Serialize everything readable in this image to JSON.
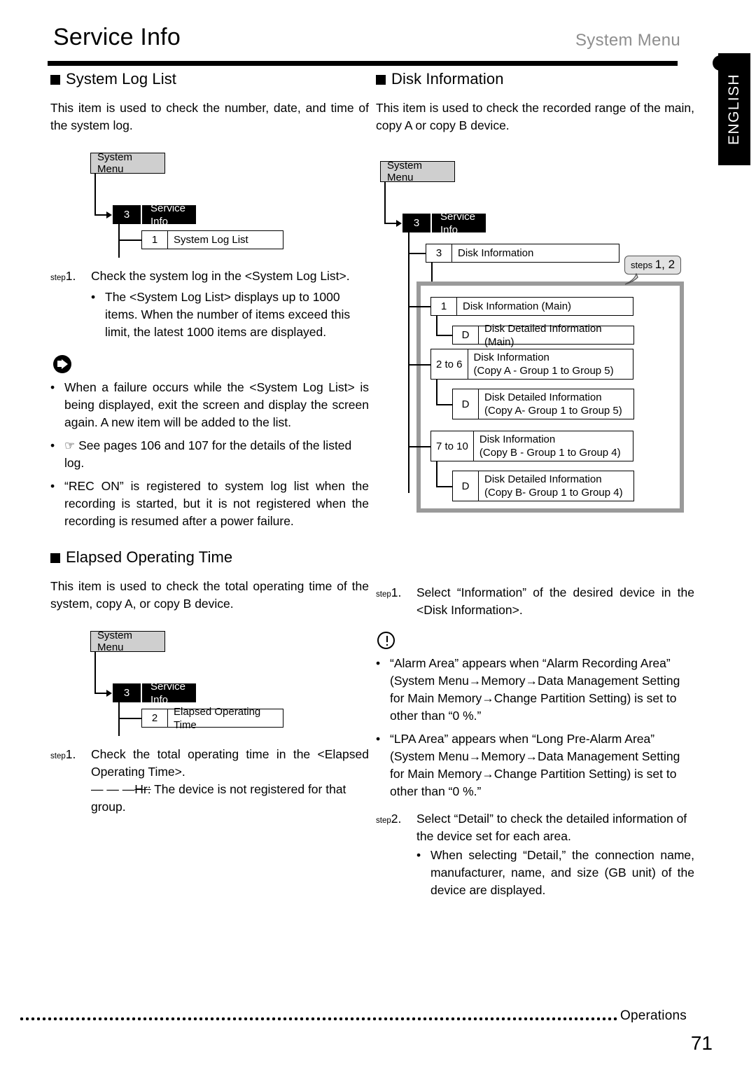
{
  "header": {
    "title": "Service Info",
    "right_label": "System Menu"
  },
  "lang_tab": {
    "label": "ENGLISH"
  },
  "left_column": {
    "section1": {
      "heading": "System Log List",
      "intro": "This item is used to check the number, date, and time of the system log.",
      "diagram": {
        "root": "System Menu",
        "selected_num": "3",
        "selected_label": "Service Info",
        "child_num": "1",
        "child_label": "System Log List"
      },
      "step1_label": "step",
      "step1_num": "1.",
      "step1_text": "Check the system log in the <System Log List>.",
      "step1_sub": "The <System Log List> displays up to 1000 items. When the number of items exceed this limit, the latest 1000 items are displayed.",
      "note_icon": "note-arrow-icon",
      "notes": [
        "When a failure occurs while the <System Log List> is being displayed, exit the screen and display the screen again. A new item will be added to the list.",
        "See pages 106 and 107 for the details of the listed log.",
        "“REC ON” is registered to system log list when the recording is started, but it is not registered when the recording is resumed after a power failure."
      ],
      "hand_icon": "pointing-hand-icon"
    },
    "section2": {
      "heading": "Elapsed Operating Time",
      "intro": "This item is used to check the total operating time of the system, copy A, or copy B device.",
      "diagram": {
        "root": "System Menu",
        "selected_num": "3",
        "selected_label": "Service Info",
        "child_num": "2",
        "child_label": "Elapsed Operating Time"
      },
      "step1_label": "step",
      "step1_num": "1.",
      "step1_text": "Check the total operating time in the <Elapsed Operating Time>.",
      "step1_dashes": "— — —",
      "step1_struck": "Hr:",
      "step1_rest": " The device is not registered for that group."
    }
  },
  "right_column": {
    "section": {
      "heading": "Disk Information",
      "intro": "This item is used to check the recorded range of the main, copy A or copy B device.",
      "diagram": {
        "root": "System Menu",
        "selected_num": "3",
        "selected_label": "Service Info",
        "child_num": "3",
        "child_label": "Disk Information",
        "callout_prefix": "steps",
        "callout_value": "1, 2",
        "items": [
          {
            "num": "1",
            "label": "Disk Information (Main)"
          },
          {
            "num": "D",
            "label": "Disk Detailed Information (Main)"
          },
          {
            "num": "2 to 6",
            "label": "Disk Information\n(Copy A - Group 1 to Group 5)"
          },
          {
            "num": "D",
            "label": "Disk Detailed Information\n(Copy A- Group 1 to Group 5)"
          },
          {
            "num": "7 to 10",
            "label": "Disk Information\n(Copy B - Group 1 to Group 4)"
          },
          {
            "num": "D",
            "label": "Disk Detailed Information\n(Copy B- Group 1 to Group 4)"
          }
        ]
      },
      "step1_label": "step",
      "step1_num": "1.",
      "step1_text": "Select “Information” of the desired device in the <Disk Information>.",
      "caution_icon": "caution-circle-icon",
      "cautions": [
        "“Alarm Area” appears when “Alarm Recording Area” (System Menu→Memory→Data Management Setting for Main Memory→Change Partition Setting) is set to other than “0 %.”",
        "“LPA Area” appears when “Long Pre-Alarm Area” (System Menu→Memory→Data Management Setting for Main Memory→Change Partition Setting) is set to other than “0 %.”"
      ],
      "step2_label": "step",
      "step2_num": "2.",
      "step2_text": "Select “Detail” to check the detailed information of the device set for each area.",
      "step2_sub": "When selecting “Detail,” the connection name, manufacturer, name, and size (GB unit) of the device are displayed."
    }
  },
  "footer": {
    "label": "Operations",
    "page_number": "71"
  }
}
